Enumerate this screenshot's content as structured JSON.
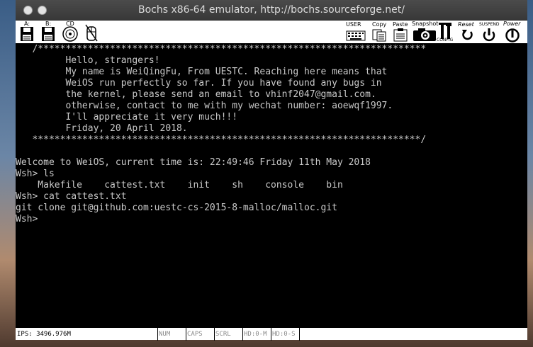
{
  "window": {
    "title": "Bochs x86-64 emulator, http://bochs.sourceforge.net/"
  },
  "toolbar": {
    "drive_a": "A:",
    "drive_b": "B:",
    "cdrom": "CD",
    "user": "USER",
    "copy": "Copy",
    "paste": "Paste",
    "snapshot": "Snapshot",
    "config": "CONFIG",
    "reset": "Reset",
    "suspend": "SUSPEND",
    "power": "Power"
  },
  "console": {
    "lines": [
      "   /**********************************************************************",
      "         Hello, strangers!",
      "         My name is WeiQingFu, From UESTC. Reaching here means that",
      "         WeiOS run perfectly so far. If you have found any bugs in",
      "         the kernel, please send an email to vhinf2047@gmail.com.",
      "         otherwise, contact to me with my wechat number: aoewqf1997.",
      "         I'll appreciate it very much!!!",
      "         Friday, 20 April 2018.",
      "   **********************************************************************/",
      "",
      "Welcome to WeiOS, current time is: 22:49:46 Friday 11th May 2018",
      "Wsh> ls",
      "    Makefile    cattest.txt    init    sh    console    bin",
      "Wsh> cat cattest.txt",
      "git clone git@github.com:uestc-cs-2015-8-malloc/malloc.git",
      "Wsh>"
    ]
  },
  "status": {
    "ips": "IPS: 3496.976M",
    "num": "NUM",
    "caps": "CAPS",
    "scrl": "SCRL",
    "hd_master": "HD:0-M",
    "hd_slave": "HD:0-S"
  }
}
